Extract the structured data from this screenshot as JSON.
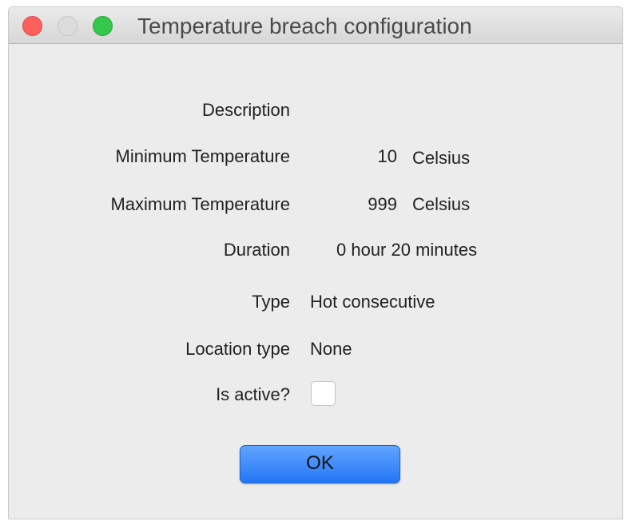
{
  "window": {
    "title": "Temperature breach configuration"
  },
  "form": {
    "description_label": "Description",
    "min_temp_label": "Minimum Temperature",
    "min_temp_value": "10",
    "min_temp_unit": "Celsius",
    "max_temp_label": "Maximum Temperature",
    "max_temp_value": "999",
    "max_temp_unit": "Celsius",
    "duration_label": "Duration",
    "duration_value": "0 hour 20 minutes",
    "type_label": "Type",
    "type_value": "Hot consecutive",
    "location_type_label": "Location type",
    "location_type_value": "None",
    "is_active_label": "Is active?",
    "is_active_checked": false
  },
  "buttons": {
    "ok_label": "OK"
  },
  "colors": {
    "close": "#fc605c",
    "minimize": "#dcdcdc",
    "zoom": "#34c84a",
    "ok_button": "#2f86f8"
  }
}
